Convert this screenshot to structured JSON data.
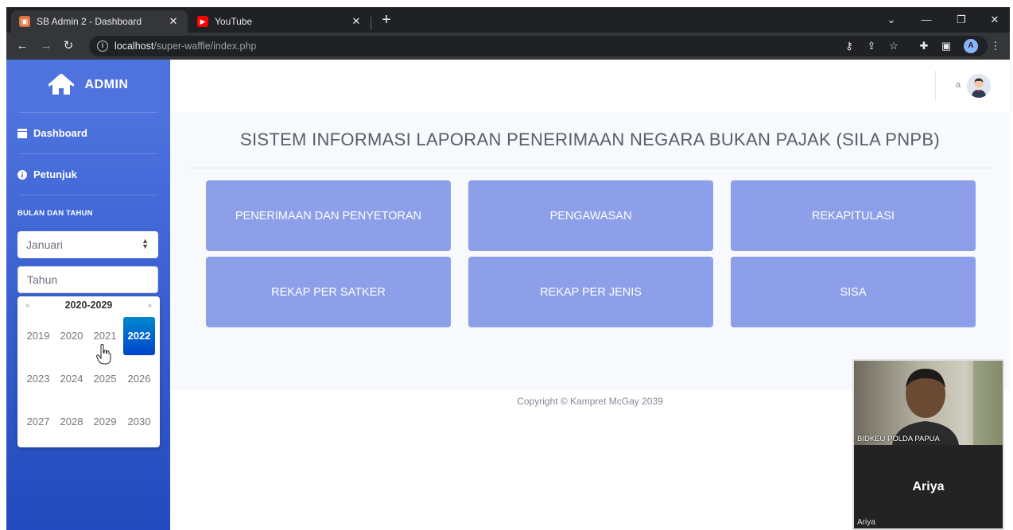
{
  "browser": {
    "tabs": [
      {
        "title": "SB Admin 2 - Dashboard",
        "active": true,
        "favicon_color": "#e37444"
      },
      {
        "title": "YouTube",
        "active": false,
        "favicon_color": "#ff0000"
      }
    ],
    "url_host": "localhost",
    "url_path": "/super-waffle/index.php",
    "profile_initial": "A"
  },
  "sidebar": {
    "brand": "ADMIN",
    "nav": [
      {
        "label": "Dashboard",
        "icon": "table-icon"
      },
      {
        "label": "Petunjuk",
        "icon": "info-circle-icon"
      }
    ],
    "heading": "BULAN DAN TAHUN",
    "month_select": {
      "value": "Januari"
    },
    "year_input": {
      "placeholder": "Tahun"
    },
    "datepicker": {
      "range": "2020-2029",
      "prev": "«",
      "next": "»",
      "years": [
        "2019",
        "2020",
        "2021",
        "2022",
        "2023",
        "2024",
        "2025",
        "2026",
        "2027",
        "2028",
        "2029",
        "2030"
      ],
      "selected": "2022"
    }
  },
  "topbar": {
    "user_name": "a"
  },
  "main": {
    "title": "SISTEM INFORMASI LAPORAN PENERIMAAN NEGARA BUKAN PAJAK (SILA PNPB)",
    "cards": [
      "PENERIMAAN DAN PENYETORAN",
      "PENGAWASAN",
      "REKAPITULASI",
      "REKAP PER SATKER",
      "REKAP PER JENIS",
      "SISA"
    ]
  },
  "footer": {
    "copyright": "Copyright © Kampret McGay 2039"
  },
  "video_call": {
    "feed_label": "BIDKEU POLDA PAPUA",
    "participant": "Ariya",
    "participant_small": "Ariya"
  },
  "colors": {
    "sidebar_top": "#4e73df",
    "sidebar_bottom": "#224abe",
    "card": "#8c9fe8",
    "selected_year": "#0044cc"
  }
}
